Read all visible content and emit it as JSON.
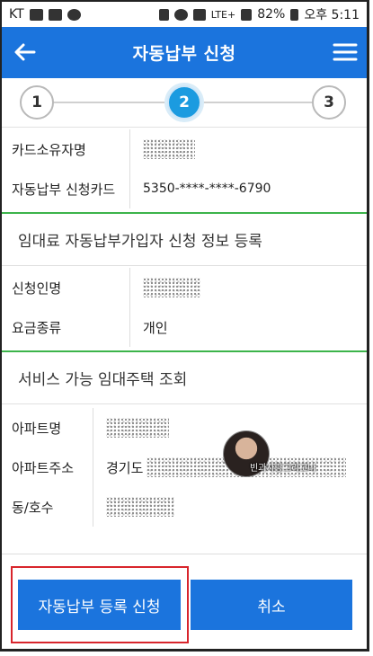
{
  "status_bar": {
    "carrier": "KT",
    "network": "LTE+",
    "battery": "82%",
    "time": "오후 5:11"
  },
  "header": {
    "title": "자동납부 신청",
    "back_icon": "arrow-left-icon",
    "menu_icon": "hamburger-menu-icon"
  },
  "stepper": {
    "steps": [
      "1",
      "2",
      "3"
    ],
    "active_step": 2
  },
  "card_section": {
    "rows": [
      {
        "label": "카드소유자명",
        "value": ""
      },
      {
        "label": "자동납부 신청카드",
        "value": "5350-****-****-6790"
      }
    ]
  },
  "applicant_section": {
    "title": "임대료 자동납부가입자 신청 정보 등록",
    "rows": [
      {
        "label": "신청인명",
        "value": ""
      },
      {
        "label": "요금종류",
        "value": "개인"
      }
    ]
  },
  "housing_section": {
    "title": "서비스 가능 임대주택 조회",
    "rows": [
      {
        "label": "아파트명",
        "value": ""
      },
      {
        "label": "아파트주소",
        "value": "경기도"
      },
      {
        "label": "동/호수",
        "value": ""
      }
    ]
  },
  "watermark": {
    "text": "빈과사랑그리고나"
  },
  "buttons": {
    "register": "자동납부 등록 신청",
    "cancel": "취소"
  },
  "colors": {
    "primary": "#1b74dd",
    "active_step": "#1b9be0",
    "divider": "#3cb44b",
    "highlight": "#d8252c"
  }
}
